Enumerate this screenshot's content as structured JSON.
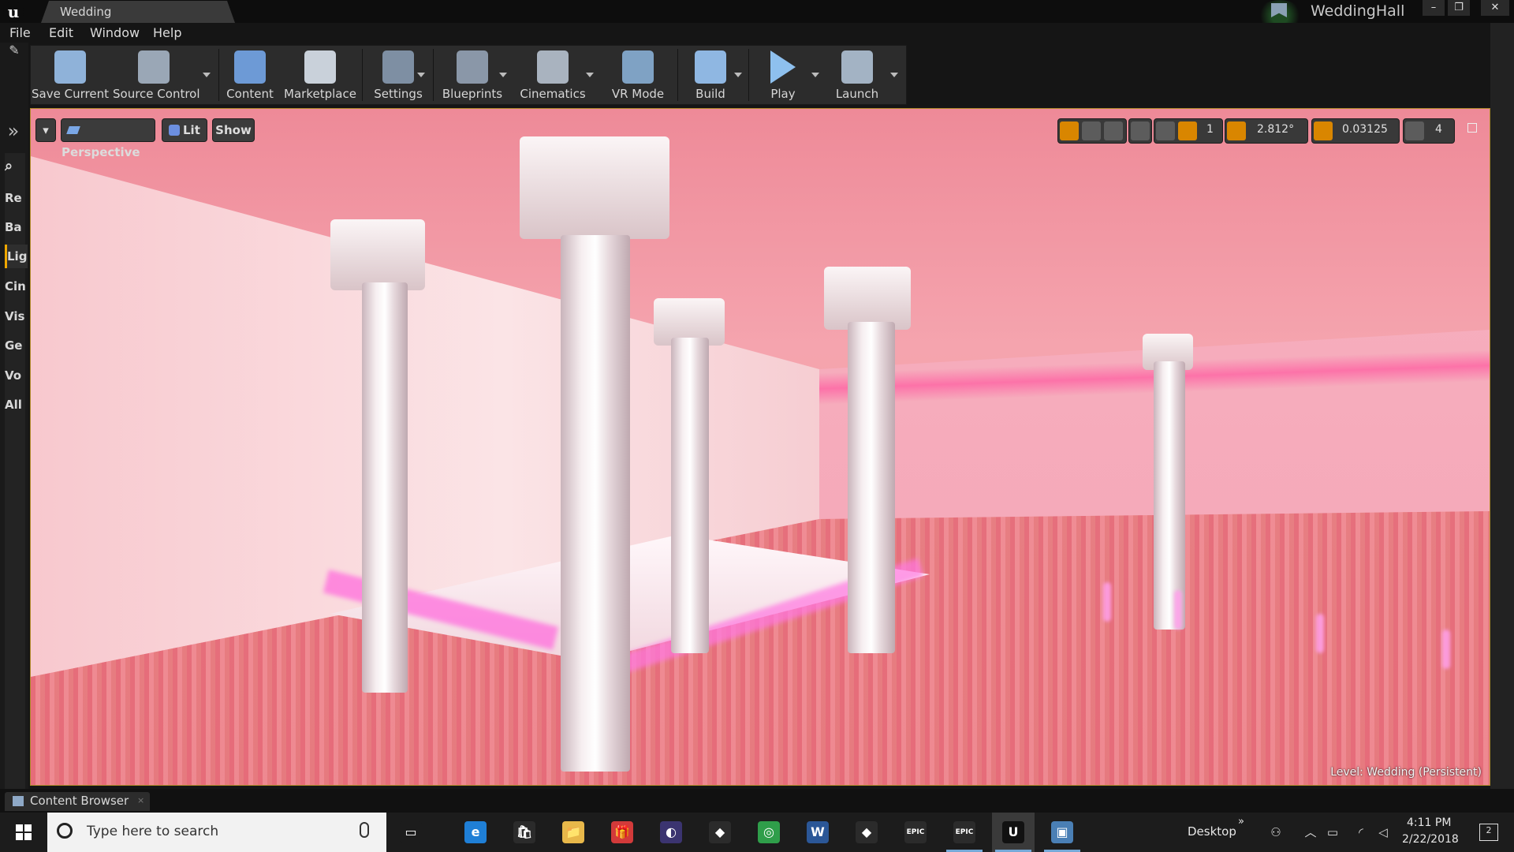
{
  "window": {
    "document_tab": "Wedding",
    "project_name": "WeddingHall",
    "controls": [
      "–",
      "❐",
      "✕"
    ]
  },
  "menu": [
    "File",
    "Edit",
    "Window",
    "Help"
  ],
  "left_panel": {
    "items": [
      "Re",
      "Ba",
      "Lig",
      "Cin",
      "Vis",
      "Ge",
      "Vo",
      "All"
    ],
    "active_index": 2
  },
  "toolbar": {
    "buttons": [
      {
        "label": "Save Current",
        "icon": "save-icon",
        "color": "#8fb2d9"
      },
      {
        "label": "Source Control",
        "icon": "source-control-icon",
        "color": "#9aa7b6"
      },
      {
        "label": "Content",
        "icon": "content-grid-icon",
        "color": "#6d9ad6"
      },
      {
        "label": "Marketplace",
        "icon": "marketplace-icon",
        "color": "#c9d1da"
      },
      {
        "label": "Settings",
        "icon": "settings-gear-icon",
        "color": "#7e8fa3"
      },
      {
        "label": "Blueprints",
        "icon": "blueprints-icon",
        "color": "#8a97a8"
      },
      {
        "label": "Cinematics",
        "icon": "clapperboard-icon",
        "color": "#a9b3bf"
      },
      {
        "label": "VR Mode",
        "icon": "vr-mode-icon",
        "color": "#7fa2c4"
      },
      {
        "label": "Build",
        "icon": "build-icon",
        "color": "#8fb7e2"
      },
      {
        "label": "Play",
        "icon": "play-icon",
        "color": "#8ec0ee"
      },
      {
        "label": "Launch",
        "icon": "launch-icon",
        "color": "#a3b3c4"
      }
    ]
  },
  "viewport": {
    "menu_dropdown": "▾",
    "perspective": "Perspective",
    "lit": "Lit",
    "show": "Show",
    "grid_snap": "1",
    "rotation_snap": "2.812°",
    "scale_snap": "0.03125",
    "camera_speed": "4",
    "level_label": "Level:  Wedding (Persistent)",
    "accent": "#d98600"
  },
  "bottom": {
    "content_browser_tab": "Content Browser",
    "close": "×"
  },
  "taskbar": {
    "search_placeholder": "Type here to search",
    "apps": [
      {
        "name": "task-view-icon",
        "glyph": "▭",
        "color": "#1c1c1c"
      },
      {
        "name": "edge-icon",
        "glyph": "e",
        "color": "#1f7fd6"
      },
      {
        "name": "store-icon",
        "glyph": "🛍",
        "color": "#2b2b2b"
      },
      {
        "name": "file-explorer-icon",
        "glyph": "📁",
        "color": "#e8b84a"
      },
      {
        "name": "gift-app-icon",
        "glyph": "🎁",
        "color": "#d23a3a"
      },
      {
        "name": "eclipse-icon",
        "glyph": "◐",
        "color": "#3b3470"
      },
      {
        "name": "unity-icon",
        "glyph": "◆",
        "color": "#2b2b2b"
      },
      {
        "name": "chrome-icon",
        "glyph": "◎",
        "color": "#2f9e4a"
      },
      {
        "name": "word-icon",
        "glyph": "W",
        "color": "#2b5797"
      },
      {
        "name": "unity-hub-icon",
        "glyph": "◆",
        "color": "#2b2b2b"
      },
      {
        "name": "epic-games-icon",
        "glyph": "EPIC",
        "color": "#2b2b2b"
      },
      {
        "name": "epic-launcher-icon",
        "glyph": "EPIC",
        "color": "#2b2b2b"
      },
      {
        "name": "unreal-editor-icon",
        "glyph": "U",
        "color": "#111"
      },
      {
        "name": "remote-desktop-icon",
        "glyph": "▣",
        "color": "#4a7fb5"
      }
    ],
    "desktop_label": "Desktop",
    "desktop_chevron": "»",
    "time": "4:11 PM",
    "date": "2/22/2018",
    "notification_count": "2"
  }
}
